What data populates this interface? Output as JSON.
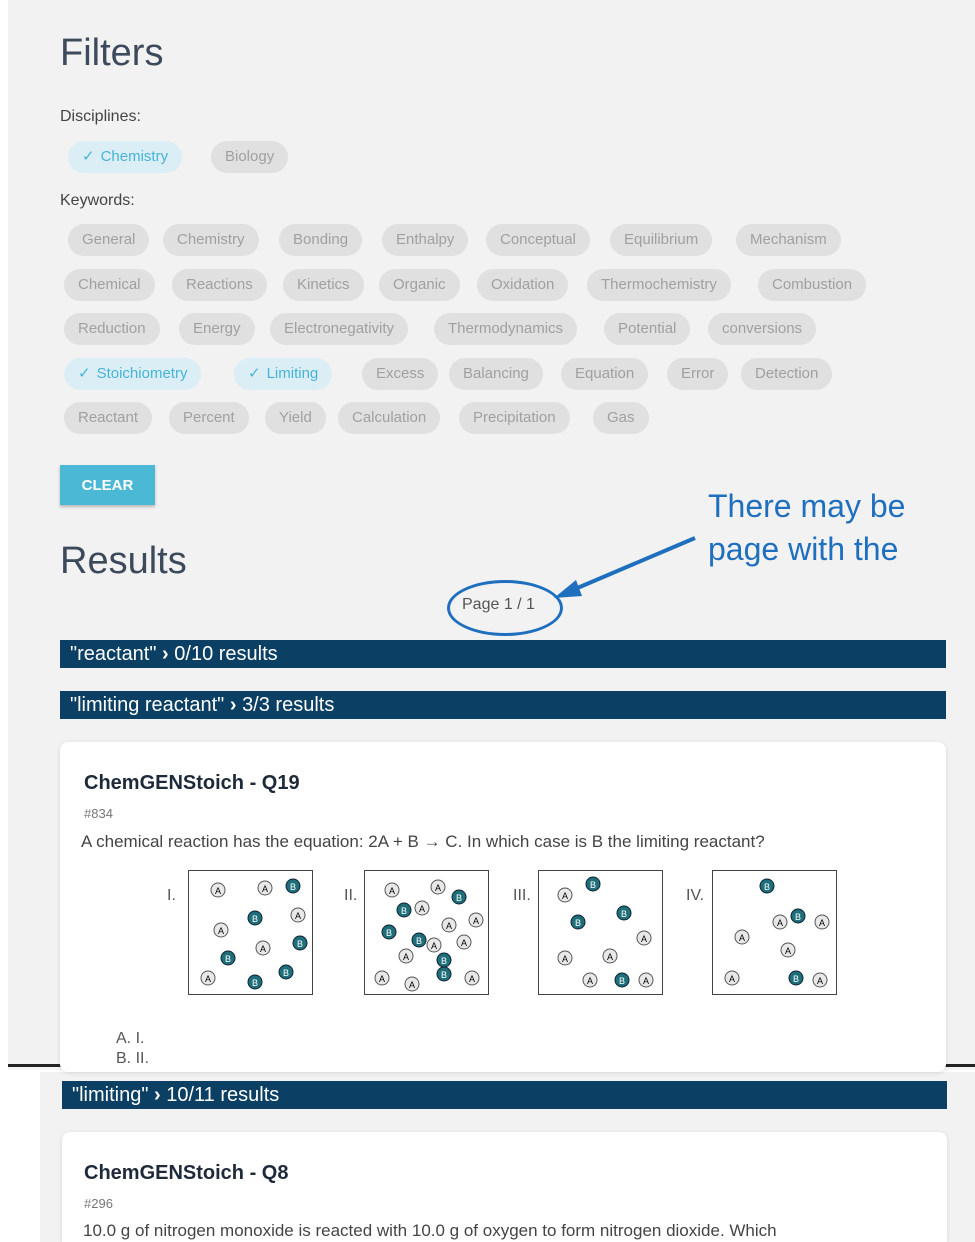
{
  "filters": {
    "title": "Filters",
    "disciplines_label": "Disciplines:",
    "disciplines": [
      {
        "label": "Chemistry",
        "selected": true
      },
      {
        "label": "Biology",
        "selected": false
      }
    ],
    "keywords_label": "Keywords:",
    "keywords": [
      {
        "label": "General",
        "selected": false
      },
      {
        "label": "Chemistry",
        "selected": false
      },
      {
        "label": "Bonding",
        "selected": false
      },
      {
        "label": "Enthalpy",
        "selected": false
      },
      {
        "label": "Conceptual",
        "selected": false
      },
      {
        "label": "Equilibrium",
        "selected": false
      },
      {
        "label": "Mechanism",
        "selected": false
      },
      {
        "label": "Chemical",
        "selected": false
      },
      {
        "label": "Reactions",
        "selected": false
      },
      {
        "label": "Kinetics",
        "selected": false
      },
      {
        "label": "Organic",
        "selected": false
      },
      {
        "label": "Oxidation",
        "selected": false
      },
      {
        "label": "Thermochemistry",
        "selected": false
      },
      {
        "label": "Combustion",
        "selected": false
      },
      {
        "label": "Reduction",
        "selected": false
      },
      {
        "label": "Energy",
        "selected": false
      },
      {
        "label": "Electronegativity",
        "selected": false
      },
      {
        "label": "Thermodynamics",
        "selected": false
      },
      {
        "label": "Potential",
        "selected": false
      },
      {
        "label": "conversions",
        "selected": false
      },
      {
        "label": "Stoichiometry",
        "selected": true
      },
      {
        "label": "Limiting",
        "selected": true
      },
      {
        "label": "Excess",
        "selected": false
      },
      {
        "label": "Balancing",
        "selected": false
      },
      {
        "label": "Equation",
        "selected": false
      },
      {
        "label": "Error",
        "selected": false
      },
      {
        "label": "Detection",
        "selected": false
      },
      {
        "label": "Reactant",
        "selected": false
      },
      {
        "label": "Percent",
        "selected": false
      },
      {
        "label": "Yield",
        "selected": false
      },
      {
        "label": "Calculation",
        "selected": false
      },
      {
        "label": "Precipitation",
        "selected": false
      },
      {
        "label": "Gas",
        "selected": false
      }
    ],
    "clear_label": "CLEAR"
  },
  "annotation": {
    "line1": "There may be",
    "line2": "page with the"
  },
  "results": {
    "title": "Results",
    "page_indicator": "Page 1 / 1",
    "groups": [
      {
        "query": "\"reactant\"",
        "count": "0/10 results"
      },
      {
        "query": "\"limiting reactant\"",
        "count": "3/3 results"
      },
      {
        "query": "\"limiting\"",
        "count": "10/11 results"
      }
    ],
    "questions": [
      {
        "title": "ChemGENStoich - Q19",
        "id": "#834",
        "text": "A chemical reaction has the equation: 2A + B → C. In which case is B the limiting reactant?",
        "figure_labels": [
          "I.",
          "II.",
          "III.",
          "IV."
        ],
        "answers": [
          "A. I.",
          "B. II."
        ]
      },
      {
        "title": "ChemGENStoich - Q8",
        "id": "#296",
        "text": "10.0 g of nitrogen monoxide is reacted with 10.0 g of oxygen to form nitrogen dioxide. Which"
      }
    ]
  },
  "colors": {
    "accent": "#4bb8d6",
    "bar": "#0b3f63",
    "annotation": "#1f6fbf",
    "particle_b": "#1f6f7a"
  },
  "icons": {
    "check": "check-icon",
    "arrow": "arrow-icon"
  }
}
